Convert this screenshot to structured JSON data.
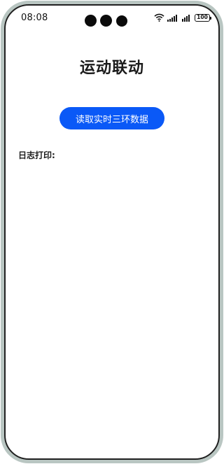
{
  "status_bar": {
    "time": "08:08",
    "battery_level": "100",
    "icons": [
      "wifi-icon",
      "cellular-signal-icon",
      "cellular-signal-icon",
      "battery-icon"
    ]
  },
  "page": {
    "title": "运动联动",
    "read_button_label": "读取实时三环数据",
    "log_label": "日志打印:"
  },
  "colors": {
    "primary_button": "#0a59f7",
    "frame": "#b9c6c2"
  }
}
